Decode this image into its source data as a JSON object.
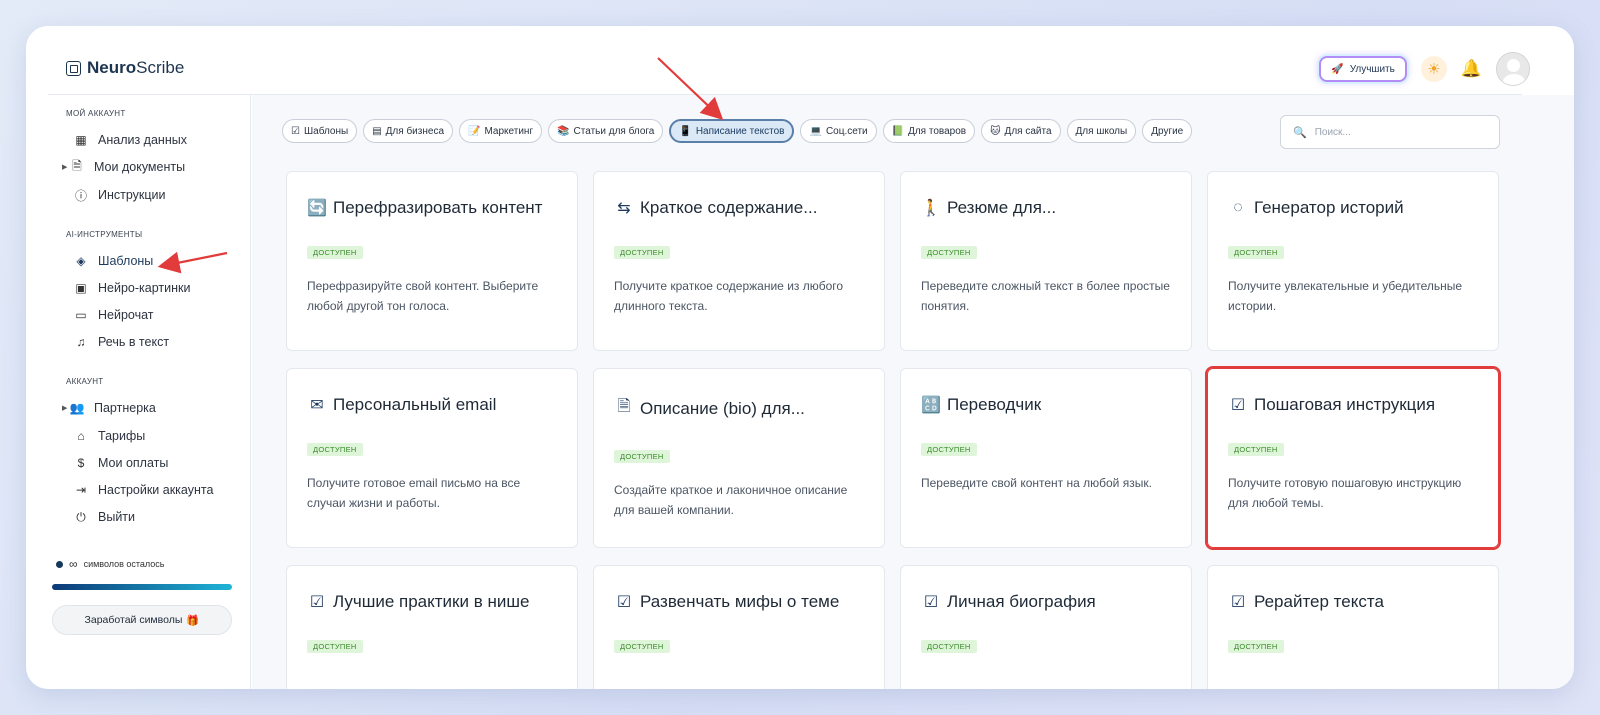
{
  "app": {
    "logo_bold": "Neuro",
    "logo_rest": "Scribe"
  },
  "header": {
    "upgrade_label": "Улучшить"
  },
  "sidebar": {
    "section_my_account": "МОЙ АККАУНТ",
    "analysis": "Анализ данных",
    "my_documents": "Мои документы",
    "instructions": "Инструкции",
    "section_ai_tools": "AI-ИНСТРУМЕНТЫ",
    "templates": "Шаблоны",
    "neuro_pictures": "Нейро-картинки",
    "neuro_chat": "Нейрочат",
    "speech_to_text": "Речь в текст",
    "section_account": "АККАУНТ",
    "partner": "Партнерка",
    "tariffs": "Тарифы",
    "payments": "Мои оплаты",
    "account_settings": "Настройки аккаунта",
    "logout": "Выйти",
    "symbols_infinity": "∞",
    "symbols_left": "символов осталось",
    "earn_button": "Заработай символы"
  },
  "filters": {
    "chips": [
      "Шаблоны",
      "Для бизнеса",
      "Маркетинг",
      "Статьи для блога",
      "Написание текстов",
      "Соц.сети",
      "Для товаров",
      "Для сайта",
      "Для школы",
      "Другие"
    ],
    "active_index": 4,
    "search_placeholder": "Поиск..."
  },
  "cards": [
    {
      "title": "Перефразировать контент",
      "badge": "ДОСТУПЕН",
      "desc": "Перефразируйте свой контент. Выберите любой другой тон голоса.",
      "icon": "refresh-icon"
    },
    {
      "title": "Краткое содержание...",
      "badge": "ДОСТУПЕН",
      "desc": "Получите краткое содержание из любого длинного текста.",
      "icon": "summary-icon"
    },
    {
      "title": "Резюме для...",
      "badge": "ДОСТУПЕН",
      "desc": "Переведите сложный текст в более простые понятия.",
      "icon": "person-icon"
    },
    {
      "title": "Генератор историй",
      "badge": "ДОСТУПЕН",
      "desc": "Получите увлекательные и убедительные истории.",
      "icon": "moon-icon"
    },
    {
      "title": "Персональный email",
      "badge": "ДОСТУПЕН",
      "desc": "Получите готовое email письмо на все случаи жизни и работы.",
      "icon": "envelope-icon"
    },
    {
      "title": "Описание (bio) для...",
      "badge": "ДОСТУПЕН",
      "desc": "Создайте краткое и лаконичное описание для вашей компании.",
      "icon": "document-icon"
    },
    {
      "title": "Переводчик",
      "badge": "ДОСТУПЕН",
      "desc": "Переведите свой контент на любой язык.",
      "icon": "translate-icon"
    },
    {
      "title": "Пошаговая инструкция",
      "badge": "ДОСТУПЕН",
      "desc": "Получите готовую пошаговую инструкцию для любой темы.",
      "icon": "checkbox-icon"
    },
    {
      "title": "Лучшие практики в нише",
      "badge": "ДОСТУПЕН",
      "desc": "",
      "icon": "checkbox-icon"
    },
    {
      "title": "Развенчать мифы о теме",
      "badge": "ДОСТУПЕН",
      "desc": "",
      "icon": "checkbox-icon"
    },
    {
      "title": "Личная биография",
      "badge": "ДОСТУПЕН",
      "desc": "",
      "icon": "checkbox-icon"
    },
    {
      "title": "Рерайтер текста",
      "badge": "ДОСТУПЕН",
      "desc": "",
      "icon": "checkbox-icon"
    }
  ],
  "colors": {
    "accent": "#1e3a5f",
    "badge_bg": "#dff5d9",
    "badge_text": "#3b8a2c",
    "highlight": "#e23b3b",
    "annotation_arrow": "#e23b3b"
  }
}
